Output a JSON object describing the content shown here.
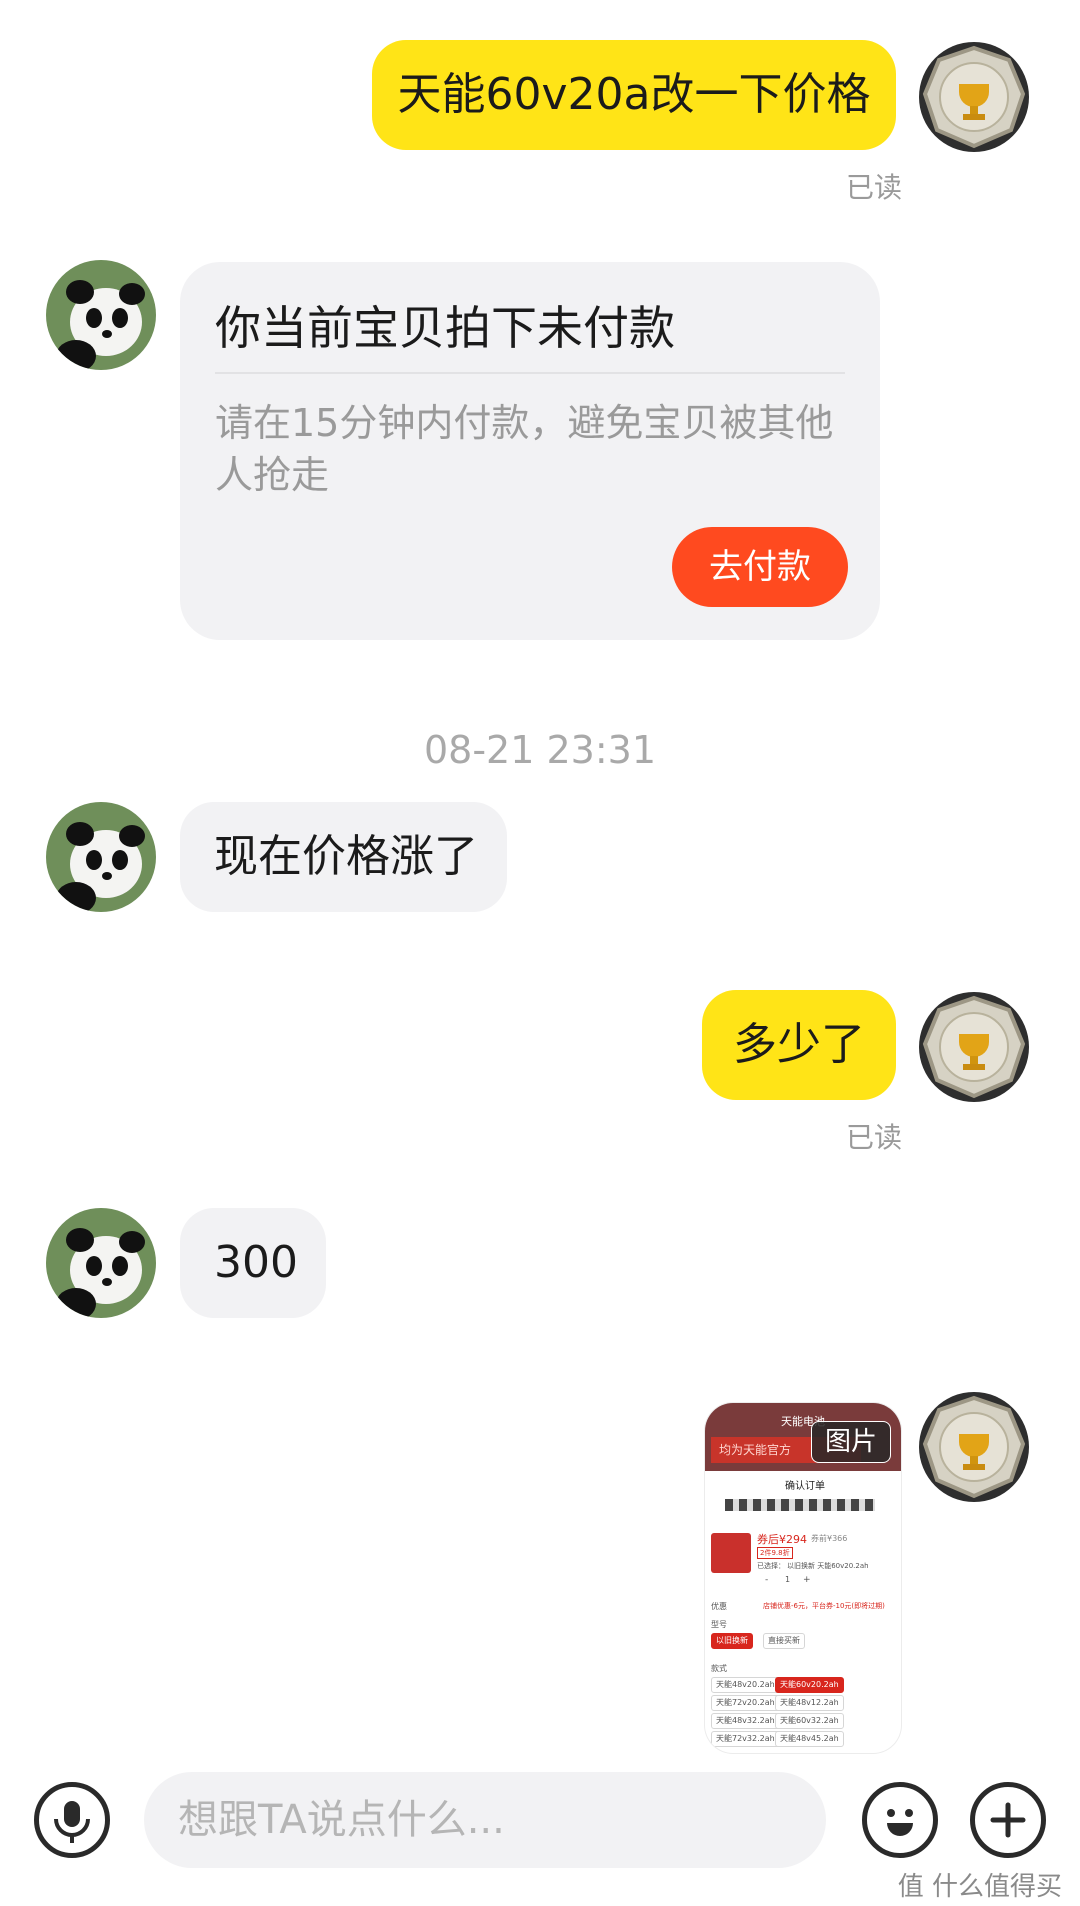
{
  "messages": {
    "m1_text": "天能60v20a改一下价格",
    "m1_read": "已读",
    "card_title": "你当前宝贝拍下未付款",
    "card_desc": "请在15分钟内付款，避免宝贝被其他人抢走",
    "card_button": "去付款",
    "time_separator": "08-21 23:31",
    "m2_text": "现在价格涨了",
    "m3_text": "多少了",
    "m3_read": "已读",
    "m4_text": "300",
    "image_badge": "图片"
  },
  "screenshot_thumb": {
    "brand": "天能电池",
    "banner": "均为天能官方",
    "title": "确认订单",
    "price_after": "券后¥294",
    "price_before": "券前¥366",
    "tag": "2件9.8折",
    "selected_label": "已选择：",
    "selected_value": "以旧换新 天能60v20.2ah",
    "qty": "1",
    "minus": "-",
    "plus": "+",
    "discount_label": "优惠",
    "discount_value": "店铺优惠-6元，平台券-10元(即将过期)",
    "model_label": "型号",
    "model_opts": [
      "以旧换新",
      "直接买新"
    ],
    "style_label": "款式",
    "style_opts": [
      "天能48v20.2ah",
      "天能60v20.2ah",
      "天能72v20.2ah",
      "天能48v12.2ah",
      "天能48v32.2ah",
      "天能60v32.2ah",
      "天能72v32.2ah",
      "天能48v45.2ah"
    ]
  },
  "composer": {
    "placeholder": "想跟TA说点什么..."
  },
  "watermark": "值 什么值得买",
  "colors": {
    "my_bubble": "#ffe417",
    "other_bubble": "#f2f2f4",
    "pay_button": "#ff4a1f"
  },
  "icons": [
    "microphone-icon",
    "emoji-icon",
    "plus-icon",
    "trophy-avatar",
    "panda-avatar"
  ]
}
